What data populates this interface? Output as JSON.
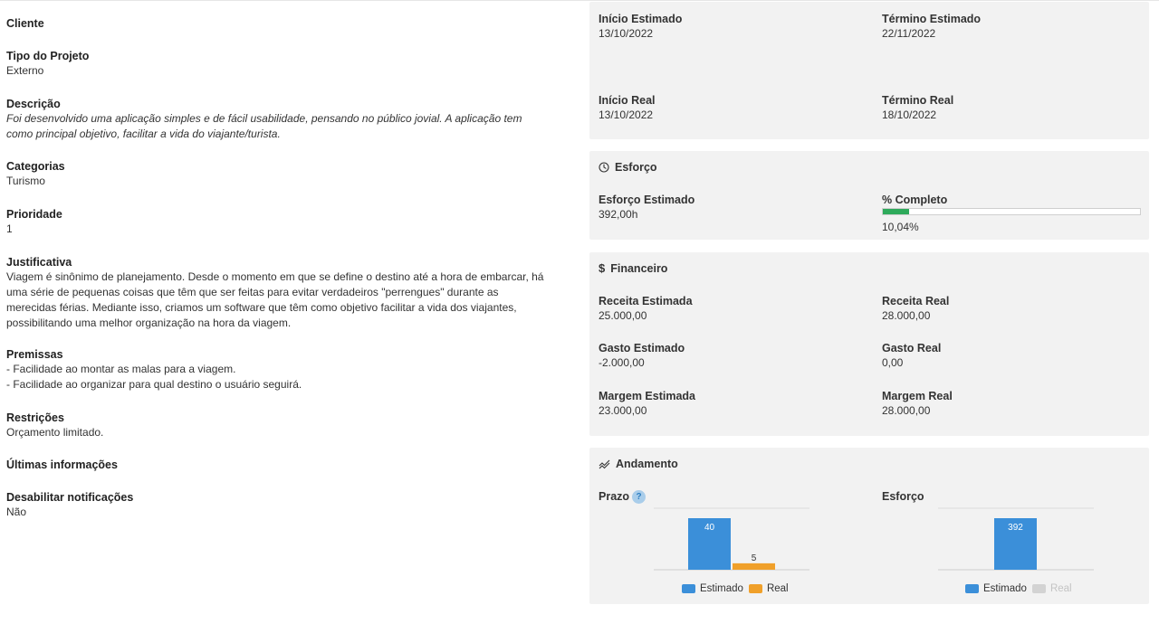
{
  "left": {
    "cliente": {
      "label": "Cliente"
    },
    "tipo": {
      "label": "Tipo do Projeto",
      "value": "Externo"
    },
    "descricao": {
      "label": "Descrição",
      "lines": [
        "Foi desenvolvido uma aplicação simples e de fácil usabilidade, pensando no público jovial. A aplicação tem",
        "como principal objetivo, facilitar a vida do viajante/turista."
      ]
    },
    "categorias": {
      "label": "Categorias",
      "value": "Turismo"
    },
    "prioridade": {
      "label": "Prioridade",
      "value": "1"
    },
    "justificativa": {
      "label": "Justificativa",
      "lines": [
        "Viagem é sinônimo de planejamento. Desde o momento em que se define o destino até a hora de embarcar, há",
        "uma série de pequenas coisas que têm que ser feitas para evitar verdadeiros \"perrengues\" durante as",
        "merecidas férias. Mediante isso, criamos um software que têm como objetivo facilitar a vida dos viajantes,",
        "possibilitando uma melhor organização na hora da viagem."
      ]
    },
    "premissas": {
      "label": "Premissas",
      "lines": [
        "- Facilidade ao montar as malas para a viagem.",
        "- Facilidade ao organizar para qual destino o usuário seguirá."
      ]
    },
    "restricoes": {
      "label": "Restrições",
      "value": "Orçamento limitado."
    },
    "ultimas": {
      "label": "Últimas informações"
    },
    "desabilitar": {
      "label": "Desabilitar notificações",
      "value": "Não"
    }
  },
  "dates": {
    "inicio_estimado": {
      "label": "Início Estimado",
      "value": "13/10/2022"
    },
    "termino_estimado": {
      "label": "Término Estimado",
      "value": "22/11/2022"
    },
    "inicio_real": {
      "label": "Início Real",
      "value": "13/10/2022"
    },
    "termino_real": {
      "label": "Término Real",
      "value": "18/10/2022"
    }
  },
  "esforco": {
    "title": "Esforço",
    "icon": "clock-icon",
    "estimado": {
      "label": "Esforço Estimado",
      "value": "392,00h"
    },
    "completo": {
      "label": "% Completo",
      "value": "10,04%",
      "fraction": 0.1004
    }
  },
  "financeiro": {
    "title": "Financeiro",
    "icon": "dollar-icon",
    "receita_estimada": {
      "label": "Receita Estimada",
      "value": "25.000,00"
    },
    "receita_real": {
      "label": "Receita Real",
      "value": "28.000,00"
    },
    "gasto_estimado": {
      "label": "Gasto Estimado",
      "value": "-2.000,00"
    },
    "gasto_real": {
      "label": "Gasto Real",
      "value": "0,00"
    },
    "margem_estimada": {
      "label": "Margem Estimada",
      "value": "23.000,00"
    },
    "margem_real": {
      "label": "Margem Real",
      "value": "28.000,00"
    }
  },
  "andamento": {
    "title": "Andamento",
    "icon": "trend-icon",
    "prazo_label": "Prazo",
    "esforco_label": "Esforço",
    "help_icon_glyph": "?"
  },
  "colors": {
    "estimado": "#3b8fd9",
    "real": "#f0a02a",
    "real_disabled": "#d3d3d3",
    "progress": "#2eaa5b"
  },
  "chart_data": [
    {
      "type": "bar",
      "title": "Prazo",
      "categories": [
        ""
      ],
      "series": [
        {
          "name": "Estimado",
          "values": [
            40
          ]
        },
        {
          "name": "Real",
          "values": [
            5
          ]
        }
      ],
      "ylim": [
        0,
        40
      ],
      "legend": "bottom",
      "grid": true
    },
    {
      "type": "bar",
      "title": "Esforço",
      "categories": [
        ""
      ],
      "series": [
        {
          "name": "Estimado",
          "values": [
            392
          ]
        },
        {
          "name": "Real",
          "values": [
            0
          ],
          "hidden": true
        }
      ],
      "ylim": [
        0,
        392
      ],
      "legend": "bottom",
      "grid": true
    }
  ]
}
